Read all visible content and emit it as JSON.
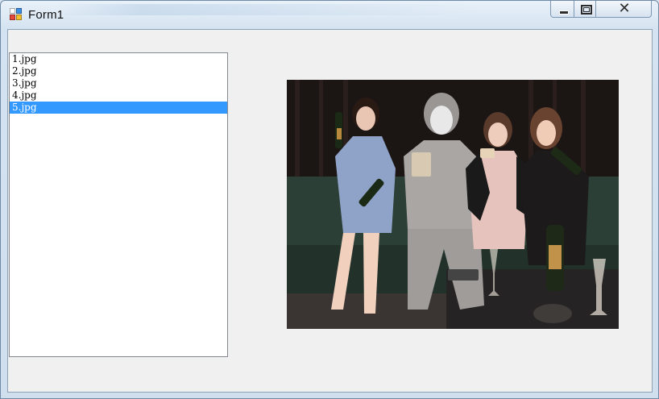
{
  "window": {
    "title": "Form1",
    "caption_buttons": [
      "minimize",
      "maximize",
      "close"
    ],
    "icon": "winforms-app-icon"
  },
  "listbox": {
    "items": [
      {
        "label": "1.jpg",
        "selected": false
      },
      {
        "label": "2.jpg",
        "selected": false
      },
      {
        "label": "3.jpg",
        "selected": false
      },
      {
        "label": "4.jpg",
        "selected": false
      },
      {
        "label": "5.jpg",
        "selected": true
      }
    ],
    "selection_color": "#3399ff"
  },
  "picturebox": {
    "content": "photo-of-four-people-with-champagne-bottles"
  }
}
